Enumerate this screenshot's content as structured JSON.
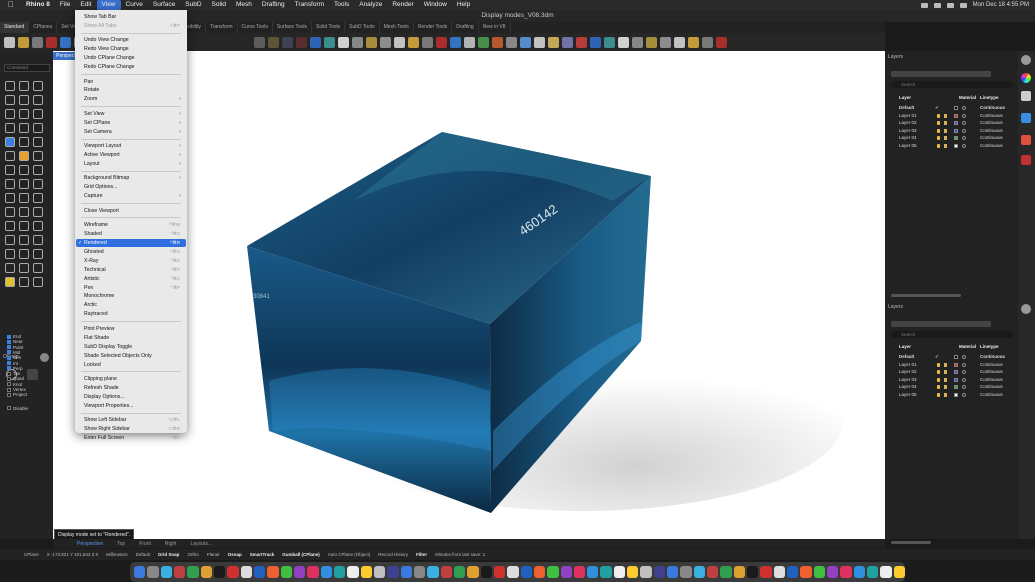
{
  "menubar": {
    "apple_icon": "apple-icon",
    "items": [
      "Rhino 8",
      "File",
      "Edit",
      "View",
      "Curve",
      "Surface",
      "SubD",
      "Solid",
      "Mesh",
      "Drafting",
      "Transform",
      "Tools",
      "Analyze",
      "Render",
      "Window",
      "Help"
    ],
    "active": "View",
    "clock": "Mon Dec 18  4:55 PM"
  },
  "window": {
    "title": "Display modes_V08.3dm"
  },
  "toolbar_tabs": [
    "Standard",
    "CPlanes",
    "Set View",
    "Display",
    "Select",
    "Viewport Layout",
    "Visibility",
    "Transform",
    "Curve Tools",
    "Surface Tools",
    "Solid Tools",
    "SubD Tools",
    "Mesh Tools",
    "Render Tools",
    "Drafting",
    "New in V8"
  ],
  "command_prompt": "Command",
  "viewport": {
    "label": "Perspective",
    "cube_text": [
      "460142",
      "30841"
    ]
  },
  "viewport_tabs": [
    "Perspective",
    "Top",
    "Front",
    "Right",
    "Layouts..."
  ],
  "tooltip": "Display mode set to \"Rendered\".",
  "osnap": {
    "title": "OSnap",
    "items": [
      {
        "label": "End",
        "on": true
      },
      {
        "label": "Near",
        "on": true
      },
      {
        "label": "Point",
        "on": true
      },
      {
        "label": "Mid",
        "on": true
      },
      {
        "label": "Cen",
        "on": true
      },
      {
        "label": "Int",
        "on": true
      },
      {
        "label": "Perp",
        "on": true
      },
      {
        "label": "Tan",
        "on": false
      },
      {
        "label": "Quad",
        "on": false
      },
      {
        "label": "Knot",
        "on": false
      },
      {
        "label": "Vertex",
        "on": false
      },
      {
        "label": "Project",
        "on": false
      },
      {
        "label": "Disable",
        "on": false
      }
    ]
  },
  "view_menu": [
    {
      "label": "Show Tab Bar",
      "shortcut": "",
      "disabled": false,
      "submenu": false
    },
    {
      "label": "Show All Tabs",
      "shortcut": "⇧⌘T",
      "disabled": true,
      "submenu": false
    },
    {
      "sep": true
    },
    {
      "label": "Undo View Change",
      "shortcut": "",
      "disabled": false,
      "submenu": false
    },
    {
      "label": "Redo View Change",
      "shortcut": "",
      "disabled": false,
      "submenu": false
    },
    {
      "label": "Undo CPlane Change",
      "shortcut": "",
      "disabled": false,
      "submenu": false
    },
    {
      "label": "Redo CPlane Change",
      "shortcut": "",
      "disabled": false,
      "submenu": false
    },
    {
      "sep": true
    },
    {
      "label": "Pan",
      "shortcut": "",
      "disabled": false,
      "submenu": false
    },
    {
      "label": "Rotate",
      "shortcut": "",
      "disabled": false,
      "submenu": false
    },
    {
      "label": "Zoom",
      "shortcut": "",
      "disabled": false,
      "submenu": true
    },
    {
      "sep": true
    },
    {
      "label": "Set View",
      "shortcut": "",
      "disabled": false,
      "submenu": true
    },
    {
      "label": "Set CPlane",
      "shortcut": "",
      "disabled": false,
      "submenu": true
    },
    {
      "label": "Set Camera",
      "shortcut": "",
      "disabled": false,
      "submenu": true
    },
    {
      "sep": true
    },
    {
      "label": "Viewport Layout",
      "shortcut": "",
      "disabled": false,
      "submenu": true
    },
    {
      "label": "Active Viewport",
      "shortcut": "",
      "disabled": false,
      "submenu": true
    },
    {
      "label": "Layout",
      "shortcut": "",
      "disabled": false,
      "submenu": true
    },
    {
      "sep": true
    },
    {
      "label": "Background Bitmap",
      "shortcut": "",
      "disabled": false,
      "submenu": true
    },
    {
      "label": "Grid Options...",
      "shortcut": "",
      "disabled": false,
      "submenu": false
    },
    {
      "label": "Capture",
      "shortcut": "",
      "disabled": false,
      "submenu": true
    },
    {
      "sep": true
    },
    {
      "label": "Close Viewport",
      "shortcut": "",
      "disabled": false,
      "submenu": false
    },
    {
      "sep": true
    },
    {
      "label": "Wireframe",
      "shortcut": "^⌘W",
      "disabled": false,
      "submenu": false
    },
    {
      "label": "Shaded",
      "shortcut": "^⌘S",
      "disabled": false,
      "submenu": false
    },
    {
      "label": "Rendered",
      "shortcut": "^⌘R",
      "disabled": false,
      "submenu": false,
      "checked": true,
      "selected": true
    },
    {
      "label": "Ghosted",
      "shortcut": "^⌘G",
      "disabled": false,
      "submenu": false
    },
    {
      "label": "X-Ray",
      "shortcut": "^⌘X",
      "disabled": false,
      "submenu": false
    },
    {
      "label": "Technical",
      "shortcut": "^⌘T",
      "disabled": false,
      "submenu": false
    },
    {
      "label": "Artistic",
      "shortcut": "^⌘A",
      "disabled": false,
      "submenu": false
    },
    {
      "label": "Pen",
      "shortcut": "^⌘P",
      "disabled": false,
      "submenu": false
    },
    {
      "label": "Monochrome",
      "shortcut": "",
      "disabled": false,
      "submenu": false
    },
    {
      "label": "Arctic",
      "shortcut": "",
      "disabled": false,
      "submenu": false
    },
    {
      "label": "Raytraced",
      "shortcut": "",
      "disabled": false,
      "submenu": false
    },
    {
      "sep": true
    },
    {
      "label": "Print Preview",
      "shortcut": "",
      "disabled": false,
      "submenu": false
    },
    {
      "label": "Flat Shade",
      "shortcut": "",
      "disabled": false,
      "submenu": false
    },
    {
      "label": "SubD Display Toggle",
      "shortcut": "",
      "disabled": false,
      "submenu": false
    },
    {
      "label": "Shade Selected Objects Only",
      "shortcut": "",
      "disabled": false,
      "submenu": false
    },
    {
      "label": "Locked",
      "shortcut": "",
      "disabled": false,
      "submenu": false
    },
    {
      "sep": true
    },
    {
      "label": "Clipping plane",
      "shortcut": "",
      "disabled": false,
      "submenu": false
    },
    {
      "label": "Refresh Shade",
      "shortcut": "",
      "disabled": false,
      "submenu": false
    },
    {
      "label": "Display Options...",
      "shortcut": "",
      "disabled": false,
      "submenu": false
    },
    {
      "label": "Viewport Properties...",
      "shortcut": "",
      "disabled": false,
      "submenu": false
    },
    {
      "sep": true
    },
    {
      "label": "Show Left Sidebar",
      "shortcut": "⌥⌘L",
      "disabled": false,
      "submenu": false
    },
    {
      "label": "Show Right Sidebar",
      "shortcut": "⌥⌘R",
      "disabled": false,
      "submenu": false
    },
    {
      "label": "Enter Full Screen",
      "shortcut": "^⌘F",
      "disabled": false,
      "submenu": false
    }
  ],
  "layers_panel_1": {
    "title": "Layers",
    "search_placeholder": "Search",
    "headers": {
      "layer": "Layer",
      "material": "Material",
      "linetype": "Linetype"
    },
    "rows": [
      {
        "name": "Default",
        "linetype": "Continuous",
        "color": "#000000",
        "bold": true
      },
      {
        "name": "Layer 01",
        "linetype": "Continuous",
        "color": "#e03030"
      },
      {
        "name": "Layer 02",
        "linetype": "Continuous",
        "color": "#7040d0"
      },
      {
        "name": "Layer 03",
        "linetype": "Continuous",
        "color": "#3050e0"
      },
      {
        "name": "Layer 04",
        "linetype": "Continuous",
        "color": "#30b040"
      },
      {
        "name": "Layer 05",
        "linetype": "Continuous",
        "color": "#ffffff"
      }
    ]
  },
  "layers_panel_2": {
    "title": "Layers",
    "search_placeholder": "Search",
    "headers": {
      "layer": "Layer",
      "material": "Material",
      "linetype": "Linetype",
      "print": "Print"
    },
    "rows": [
      {
        "name": "Default",
        "linetype": "Continuous",
        "print": "Defa",
        "color": "#000000",
        "bold": true
      },
      {
        "name": "Layer 01",
        "linetype": "Continuous",
        "print": "Defa",
        "color": "#e03030"
      },
      {
        "name": "Layer 02",
        "linetype": "Continuous",
        "print": "Defa",
        "color": "#7040d0"
      },
      {
        "name": "Layer 03",
        "linetype": "Continuous",
        "print": "Defa",
        "color": "#3050e0"
      },
      {
        "name": "Layer 04",
        "linetype": "Continuous",
        "print": "Defa",
        "color": "#30b040"
      },
      {
        "name": "Layer 05",
        "linetype": "Continuous",
        "print": "Defa",
        "color": "#ffffff"
      }
    ]
  },
  "statusbar": {
    "cplane": "CPlane",
    "coords": "X -173.821 Y 101.644 Z 0",
    "units": "Millimeters",
    "layer": "Default",
    "toggles": [
      "Grid Snap",
      "Ortho",
      "Planar",
      "Osnap",
      "SmartTrack",
      "Gumball (CPlane)",
      "Auto CPlane (Object)",
      "Record History",
      "Filter"
    ],
    "bold_toggles": [
      "Grid Snap",
      "Osnap",
      "SmartTrack",
      "Gumball (CPlane)",
      "Filter"
    ],
    "saved": "Minutes from last save: 1"
  },
  "colors": {
    "accent": "#2f6fe0",
    "menu_bg": "#e9e9e9",
    "panel_bg": "#222222"
  }
}
